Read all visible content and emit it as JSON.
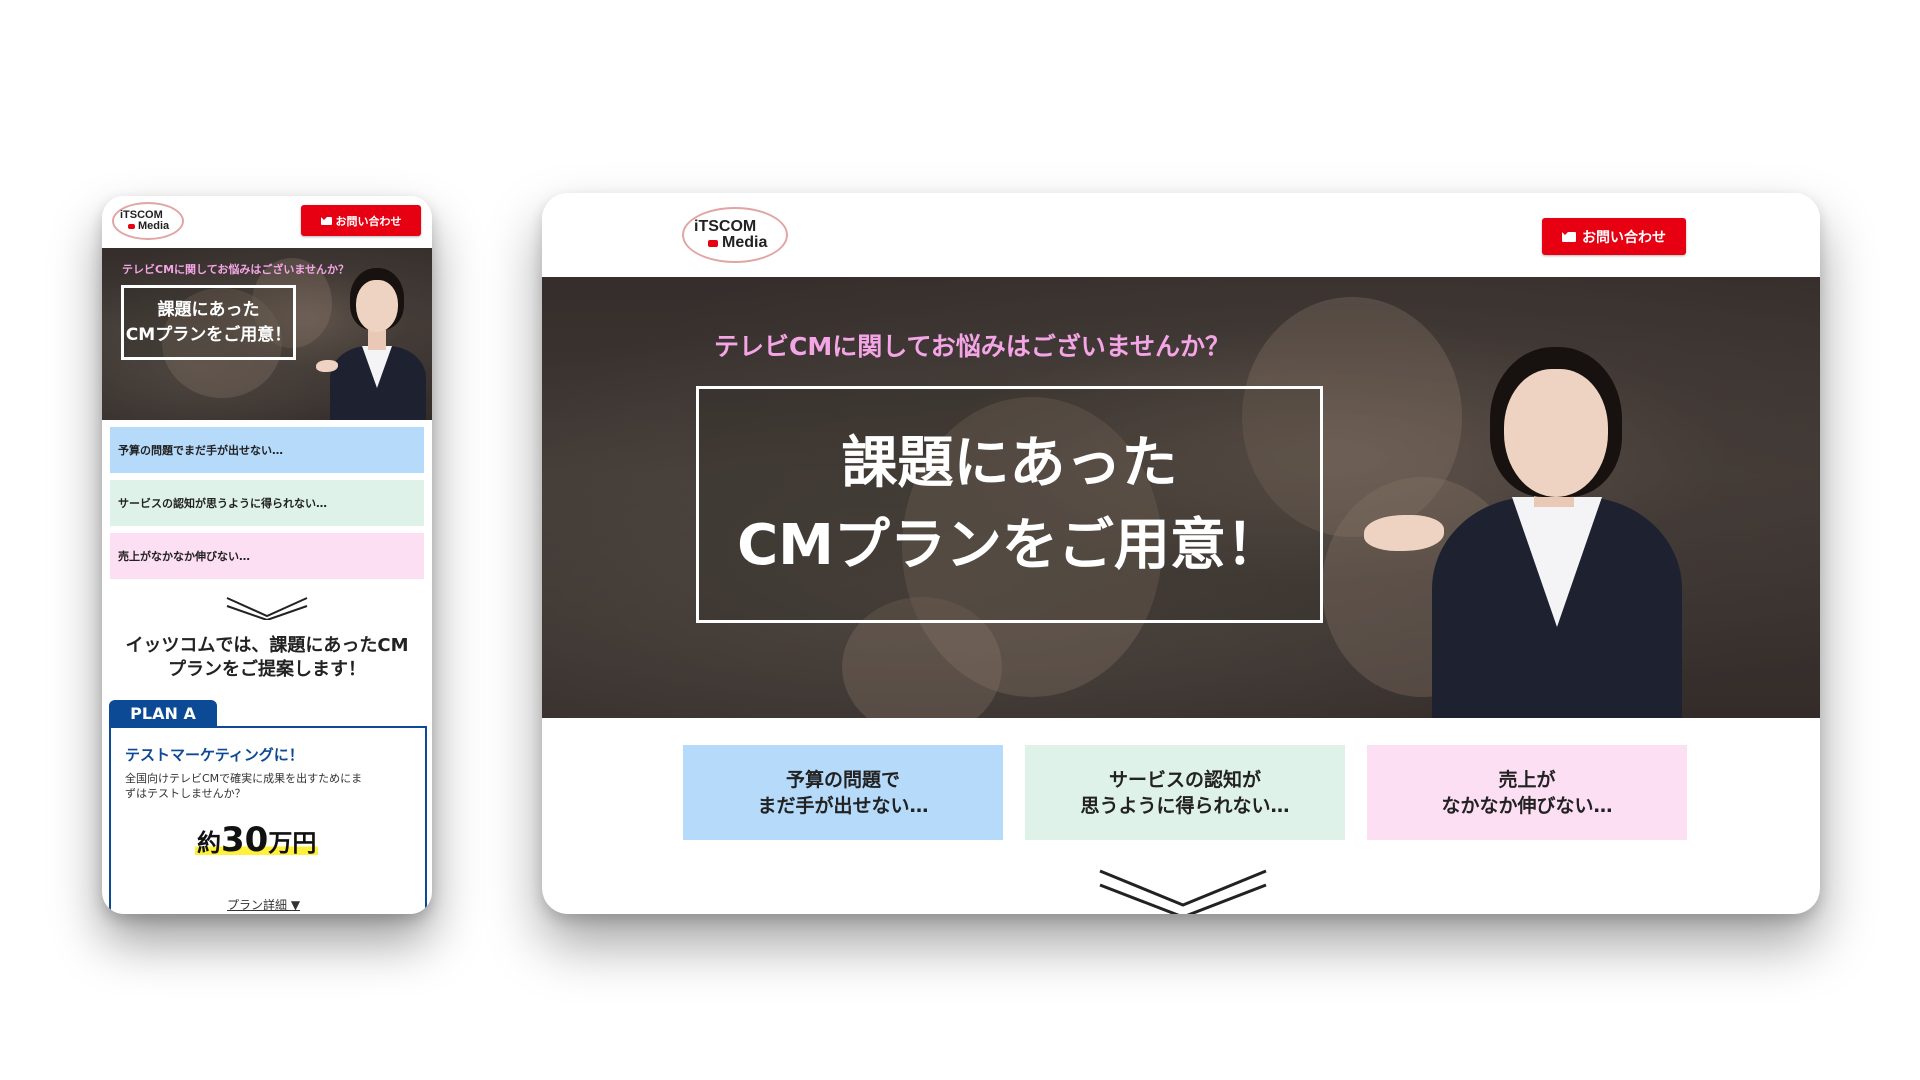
{
  "brand": {
    "logo_line1": "iTSCOM",
    "logo_line2": "Media",
    "accent": "#e60012"
  },
  "contact_button": {
    "label": "お問い合わせ",
    "icon": "mail-icon"
  },
  "hero": {
    "lead": "テレビCMに関してお悩みはございませんか？",
    "headline_line1": "課題にあった",
    "headline_line2": "CMプランをご用意！"
  },
  "concerns": {
    "mobile": [
      {
        "text": "予算の問題でまだ手が出せない…",
        "color": "#b5dafa"
      },
      {
        "text": "サービスの認知が思うように得られない…",
        "color": "#dff2ea"
      },
      {
        "text": "売上がなかなか伸びない…",
        "color": "#fddff3"
      }
    ],
    "desktop": [
      {
        "line1": "予算の問題で",
        "line2": "まだ手が出せない…",
        "color": "#b5dafa"
      },
      {
        "line1": "サービスの認知が",
        "line2": "思うように得られない…",
        "color": "#dff2ea"
      },
      {
        "line1": "売上が",
        "line2": "なかなか伸びない…",
        "color": "#fddff3"
      }
    ]
  },
  "proposal": {
    "line1": "イッツコムでは、課題にあったCM",
    "line2": "プランをご提案します！"
  },
  "plan_a": {
    "tab": "PLAN A",
    "title": "テストマーケティングに！",
    "desc_line1": "全国向けテレビCMで確実に成果を出すためにま",
    "desc_line2": "ずはテストしませんか？",
    "price_prefix": "約",
    "price_number": "30",
    "price_unit": "万円",
    "detail_link": "プラン詳細 ▼",
    "tab_color": "#0d4a96"
  }
}
